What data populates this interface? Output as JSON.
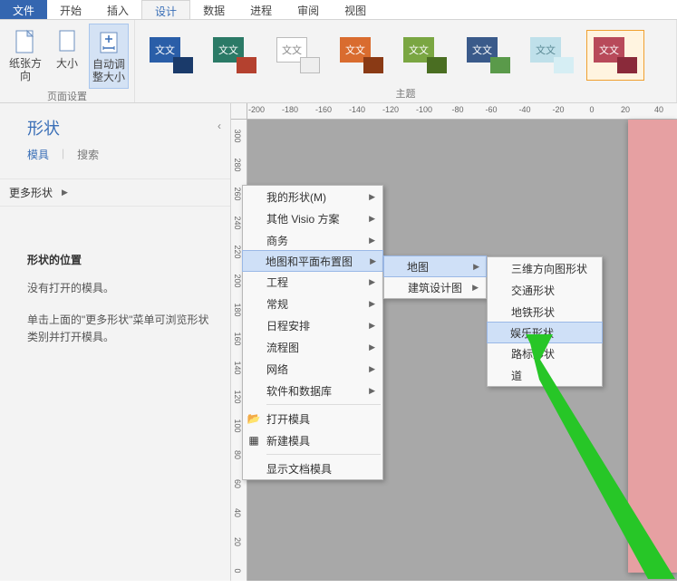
{
  "tabs": {
    "file": "文件",
    "home": "开始",
    "insert": "插入",
    "design": "设计",
    "data": "数据",
    "process": "进程",
    "review": "审阅",
    "view": "视图"
  },
  "ribbon": {
    "page_setup": {
      "label": "页面设置",
      "orientation": "纸张方向",
      "size": "大小",
      "autosize": "自动调整大小"
    },
    "themes_label": "主题",
    "theme_text": "文文"
  },
  "side": {
    "title": "形状",
    "tab1": "模具",
    "tab2": "搜索",
    "more": "更多形状",
    "pos_title": "形状的位置",
    "pos_p1": "没有打开的模具。",
    "pos_p2": "单击上面的\"更多形状\"菜单可浏览形状类别并打开模具。"
  },
  "ruler_h": [
    -200,
    -180,
    -160,
    -140,
    -120,
    -100,
    -80,
    -60,
    -40,
    -20,
    0,
    20,
    40
  ],
  "ruler_v": [
    300,
    280,
    260,
    240,
    220,
    200,
    180,
    160,
    140,
    120,
    100,
    80,
    60,
    40,
    20,
    0
  ],
  "menu1": {
    "myshapes": "我的形状(M)",
    "othervisio": "其他 Visio 方案",
    "business": "商务",
    "maps": "地图和平面布置图",
    "engineering": "工程",
    "general": "常规",
    "schedule": "日程安排",
    "flowchart": "流程图",
    "network": "网络",
    "software": "软件和数据库",
    "open": "打开模具",
    "new": "新建模具",
    "showdoc": "显示文档模具"
  },
  "menu2": {
    "map": "地图",
    "arch": "建筑设计图"
  },
  "menu3": {
    "threeD": "三维方向图形状",
    "traffic": "交通形状",
    "subway": "地铁形状",
    "entertain": "娱乐形状",
    "road": "路标形状",
    "prefix": "道"
  }
}
